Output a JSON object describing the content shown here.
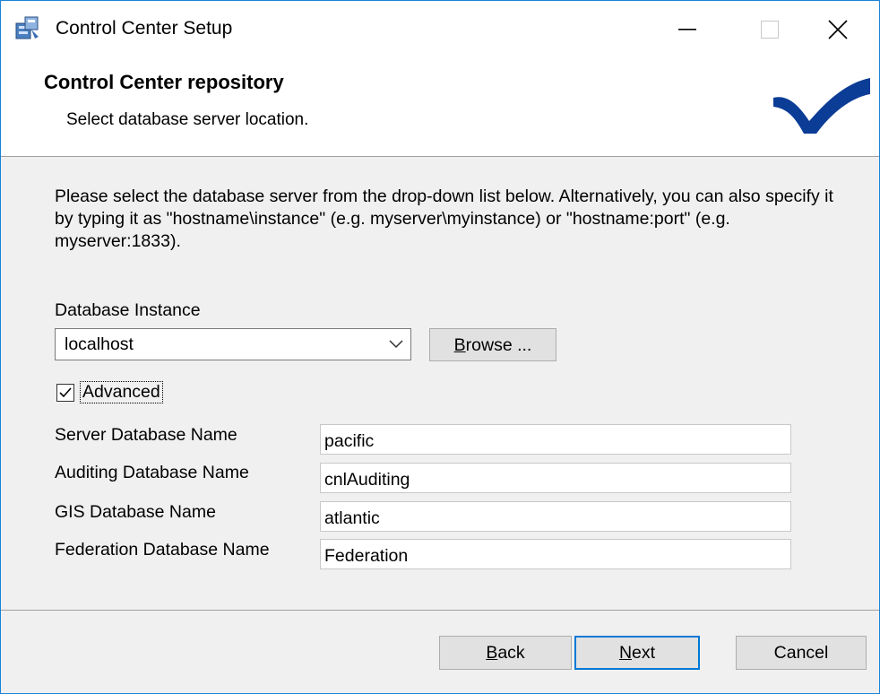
{
  "window": {
    "title": "Control Center Setup",
    "minimize_icon": "minimize-icon",
    "maximize_icon": "maximize-icon",
    "close_icon": "close-icon"
  },
  "header": {
    "title": "Control Center repository",
    "subtitle": "Select database server location.",
    "logo_color": "#0b3c96"
  },
  "body": {
    "description": "Please select the database server from the drop-down list below.  Alternatively, you can also specify it by typing it as \"hostname\\instance\" (e.g. myserver\\myinstance) or \"hostname:port\" (e.g. myserver:1833).",
    "instance_label": "Database Instance",
    "instance_value": "localhost",
    "browse_prefix": "B",
    "browse_rest": "rowse ...",
    "advanced_label": "Advanced",
    "advanced_checked": true,
    "fields": [
      {
        "label": "Server Database Name",
        "value": "pacific"
      },
      {
        "label": "Auditing Database Name",
        "value": "cnlAuditing"
      },
      {
        "label": "GIS Database Name",
        "value": "atlantic"
      },
      {
        "label": "Federation Database Name",
        "value": "Federation"
      }
    ]
  },
  "footer": {
    "back_prefix": "B",
    "back_rest": "ack",
    "next_prefix": "N",
    "next_rest": "ext",
    "cancel_label": "Cancel"
  }
}
